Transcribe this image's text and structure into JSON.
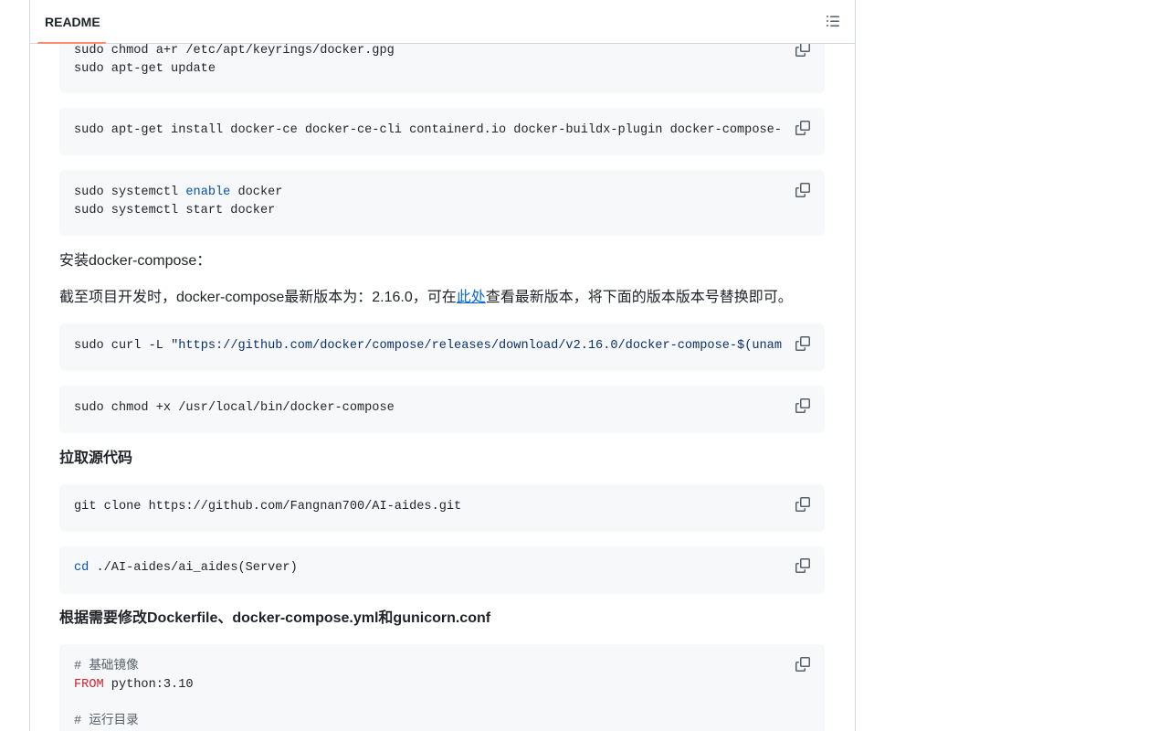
{
  "header": {
    "tab_label": "README"
  },
  "blocks": {
    "apt_update": {
      "lines": [
        "sudo chmod a+r /etc/apt/keyrings/docker.gpg",
        "sudo apt-get update"
      ]
    },
    "install": {
      "line": "sudo apt-get install docker-ce docker-ce-cli containerd.io docker-buildx-plugin docker-compose-"
    },
    "systemctl": {
      "l1_a": "sudo systemctl ",
      "l1_kw": "enable",
      "l1_b": " docker",
      "l2": "sudo systemctl start docker"
    },
    "curl": {
      "prefix": "sudo curl -L ",
      "string": "\"https://github.com/docker/compose/releases/download/v2.16.0/docker-compose-$(unam"
    },
    "chmod": {
      "line": "sudo chmod +x /usr/local/bin/docker-compose"
    },
    "clone": {
      "line": "git clone https://github.com/Fangnan700/AI-aides.git"
    },
    "cd": {
      "kw": "cd",
      "rest": " ./AI-aides/ai_aides(Server)"
    },
    "dockerfile": {
      "c1": "# 基础镜像",
      "from_kw": "FROM",
      "from_rest": " python:3.10",
      "c2": "# 运行目录"
    }
  },
  "text": {
    "install_compose": "安装docker-compose：",
    "version_before": "截至项目开发时，docker-compose最新版本为：2.16.0，可在",
    "version_link": "此处",
    "version_after": "查看最新版本，将下面的版本版本号替换即可。",
    "pull_heading": "拉取源代码",
    "modify_heading": "根据需要修改Dockerfile、docker-compose.yml和gunicorn.conf"
  },
  "icons": {
    "toc": "list-unordered-icon",
    "copy": "copy-icon"
  }
}
